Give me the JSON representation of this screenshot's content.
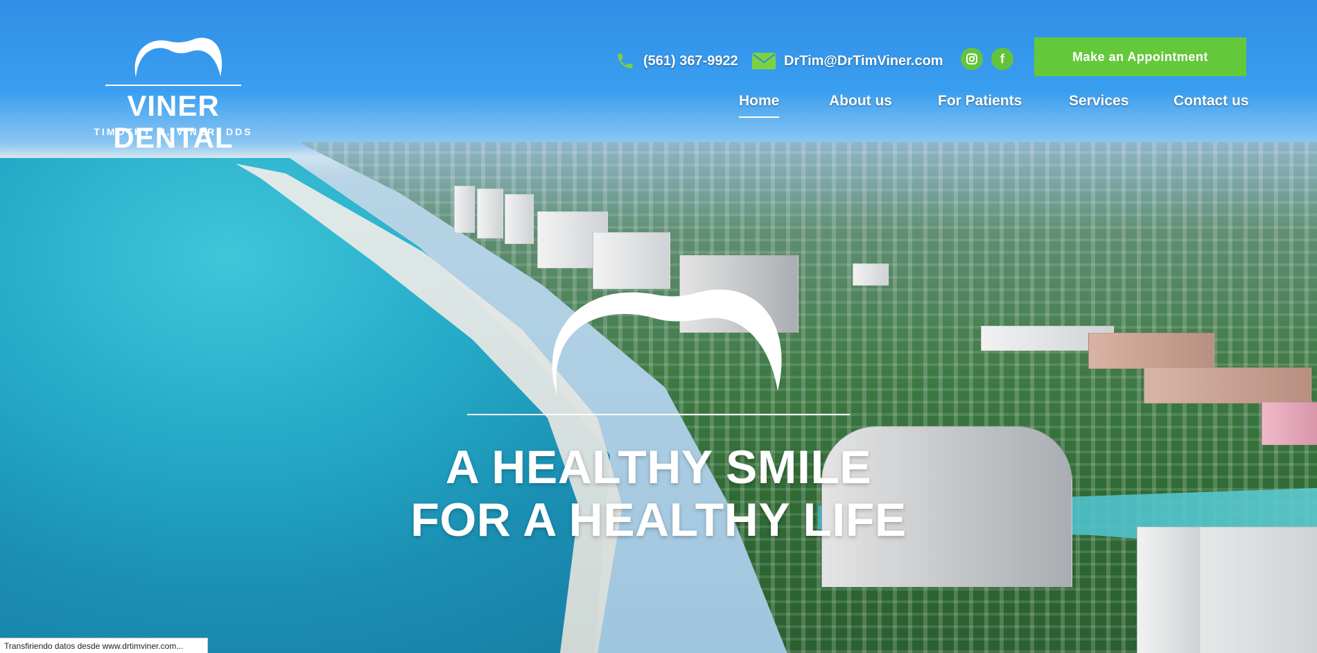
{
  "brand": {
    "name": "VINER DENTAL",
    "subtitle": "TIMOTHY M. VINER, DDS"
  },
  "contact": {
    "phone": "(561) 367-9922",
    "email": "DrTim@DrTimViner.com",
    "phone_icon": "phone-icon",
    "email_icon": "envelope-icon"
  },
  "social": [
    {
      "name": "instagram",
      "glyph": "◙"
    },
    {
      "name": "facebook",
      "glyph": "f"
    }
  ],
  "cta": {
    "label": "Make an Appointment"
  },
  "nav": {
    "items": [
      {
        "label": "Home",
        "active": true
      },
      {
        "label": "About us",
        "active": false
      },
      {
        "label": "For Patients",
        "active": false
      },
      {
        "label": "Services",
        "active": false
      },
      {
        "label": "Contact us",
        "active": false
      }
    ]
  },
  "hero": {
    "line1": "A HEALTHY SMILE",
    "line2": "FOR A HEALTHY LIFE"
  },
  "status_bar": {
    "text": "Transfiriendo datos desde www.drtimviner.com..."
  },
  "colors": {
    "accent_green": "#64c83b",
    "sky_blue": "#2f8fe6",
    "text_white": "#ffffff"
  }
}
